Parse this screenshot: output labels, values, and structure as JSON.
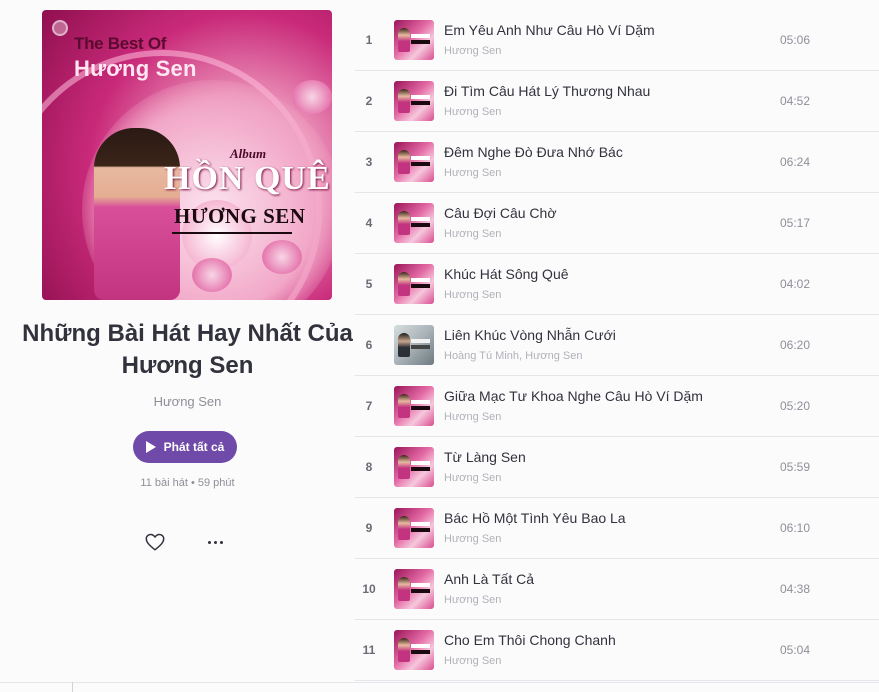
{
  "album": {
    "cover_text": {
      "line1": "The Best Of",
      "line2": "Hương Sen",
      "album_word": "Album",
      "hon_que": "HỒN QUÊ",
      "singer": "HƯƠNG SEN"
    },
    "title": "Những Bài Hát Hay Nhất Của Hương Sen",
    "artist": "Hương Sen",
    "play_all_label": "Phát tất cả",
    "meta": "11 bài hát • 59 phút"
  },
  "songs": [
    {
      "num": "1",
      "title": "Em Yêu Anh Như Câu Hò Ví Dặm",
      "artist": "Hương Sen",
      "duration": "05:06"
    },
    {
      "num": "2",
      "title": "Đi Tìm Câu Hát Lý Thương Nhau",
      "artist": "Hương Sen",
      "duration": "04:52"
    },
    {
      "num": "3",
      "title": "Đêm Nghe Đò Đưa Nhớ Bác",
      "artist": "Hương Sen",
      "duration": "06:24"
    },
    {
      "num": "4",
      "title": "Câu Đợi Câu Chờ",
      "artist": "Hương Sen",
      "duration": "05:17"
    },
    {
      "num": "5",
      "title": "Khúc Hát Sông Quê",
      "artist": "Hương Sen",
      "duration": "04:02"
    },
    {
      "num": "6",
      "title": "Liên Khúc Vòng Nhẫn Cưới",
      "artist": "Hoàng Tú Minh, Hương Sen",
      "duration": "06:20"
    },
    {
      "num": "7",
      "title": "Giữa Mạc Tư Khoa Nghe Câu Hò Ví Dặm",
      "artist": "Hương Sen",
      "duration": "05:20"
    },
    {
      "num": "8",
      "title": "Từ Làng Sen",
      "artist": "Hương Sen",
      "duration": "05:59"
    },
    {
      "num": "9",
      "title": "Bác Hồ Một Tình Yêu Bao La",
      "artist": "Hương Sen",
      "duration": "06:10"
    },
    {
      "num": "10",
      "title": "Anh Là Tất Cả",
      "artist": "Hương Sen",
      "duration": "04:38"
    },
    {
      "num": "11",
      "title": "Cho Em Thôi Chong Chanh",
      "artist": "Hương Sen",
      "duration": "05:04"
    }
  ],
  "icons": {
    "play": "play-icon",
    "heart": "heart-icon",
    "more": "more-icon"
  },
  "colors": {
    "accent": "#6f4aa8",
    "text": "#32323d",
    "muted": "#8f8f99"
  }
}
